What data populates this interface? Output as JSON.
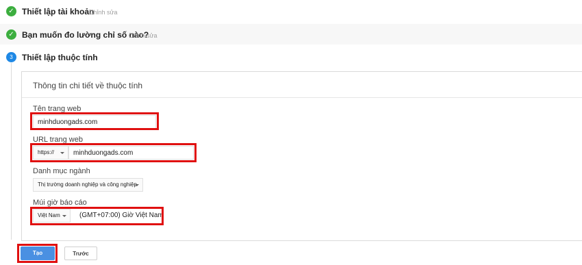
{
  "steps": [
    {
      "title": "Thiết lập tài khoản",
      "edit": "Chỉnh sửa",
      "status": "done"
    },
    {
      "title": "Bạn muốn đo lường chỉ số nào?",
      "edit": "Chỉnh sửa",
      "status": "done"
    },
    {
      "title": "Thiết lập thuộc tính",
      "number": "3",
      "status": "current"
    }
  ],
  "icons": {
    "done": "check-icon",
    "dropdown": "caret-down-icon"
  },
  "colors": {
    "done": "#3cae3f",
    "current": "#1e88e5",
    "highlight": "#e01010",
    "primary_button": "#4a90e2"
  },
  "card": {
    "title": "Thông tin chi tiết về thuộc tính",
    "website_name": {
      "label": "Tên trang web",
      "value": "minhduongads.com"
    },
    "website_url": {
      "label": "URL trang web",
      "protocol": "https://",
      "value": "minhduongads.com"
    },
    "industry": {
      "label": "Danh mục ngành",
      "value": "Thị trường doanh nghiệp và công nghiệp"
    },
    "timezone": {
      "label": "Múi giờ báo cáo",
      "country": "Việt Nam",
      "zone": "(GMT+07:00) Giờ Việt Nam"
    }
  },
  "buttons": {
    "create": "Tạo",
    "previous": "Trước"
  }
}
